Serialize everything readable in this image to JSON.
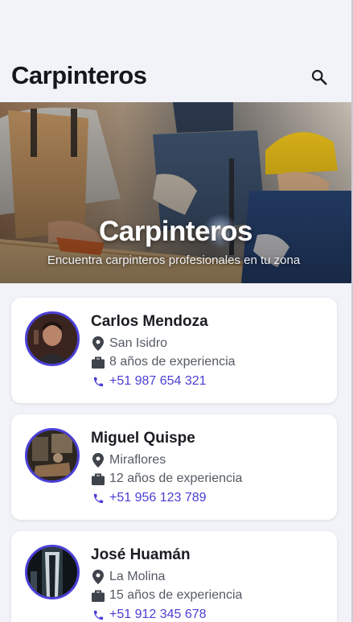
{
  "app": {
    "title": "Carpinteros",
    "search_icon": "search-icon"
  },
  "hero": {
    "title": "Carpinteros",
    "subtitle": "Encuentra carpinteros profesionales en tu zona"
  },
  "colors": {
    "accent": "#4a3fd4",
    "background": "#f1f3f8",
    "card": "#ffffff",
    "text_primary": "#1b1d22",
    "text_secondary": "#555a63"
  },
  "icons": {
    "location": "location-pin-icon",
    "experience": "briefcase-icon",
    "phone": "phone-icon"
  },
  "carpenters": [
    {
      "name": "Carlos Mendoza",
      "location": "San Isidro",
      "experience": "8 años de experiencia",
      "phone": "+51 987 654 321"
    },
    {
      "name": "Miguel Quispe",
      "location": "Miraflores",
      "experience": "12 años de experiencia",
      "phone": "+51 956 123 789"
    },
    {
      "name": "José Huamán",
      "location": "La Molina",
      "experience": "15 años de experiencia",
      "phone": "+51 912 345 678"
    }
  ]
}
